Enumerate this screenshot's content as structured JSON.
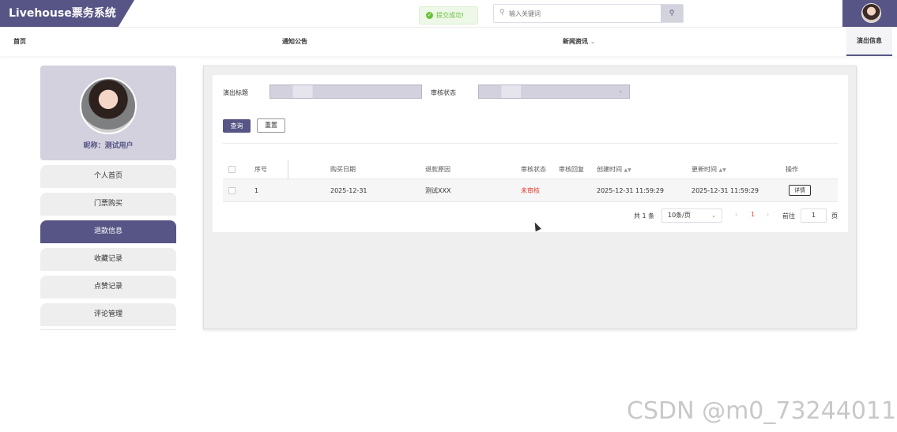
{
  "app": {
    "title": "Livehouse票务系统"
  },
  "toast": {
    "text": "提交成功!"
  },
  "search": {
    "placeholder": "输入关键词",
    "search_icon": "search-icon",
    "button_icon": "search-icon"
  },
  "nav": {
    "items": [
      {
        "label": "首页"
      },
      {
        "label": "通知公告"
      },
      {
        "label": "新闻资讯",
        "chevron": "chevron-down-icon"
      },
      {
        "label": "演出信息",
        "active": true
      }
    ]
  },
  "profile": {
    "nickname": "昵称：测试用户"
  },
  "sidebar": {
    "items": [
      {
        "label": "个人首页"
      },
      {
        "label": "门票购买"
      },
      {
        "label": "退款信息",
        "active": true
      },
      {
        "label": "收藏记录"
      },
      {
        "label": "点赞记录"
      },
      {
        "label": "评论管理"
      }
    ]
  },
  "filters": {
    "title_label": "演出标题",
    "status_label": "审核状态",
    "title_value": "",
    "status_value": ""
  },
  "buttons": {
    "query": "查询",
    "reset": "重置"
  },
  "table": {
    "headers": [
      "序号",
      "购买日期",
      "退款原因",
      "审核状态",
      "审核回复",
      "创建时间",
      "更新时间",
      "操作"
    ],
    "rows": [
      {
        "index": "1",
        "purchase_date": "2025-12-31",
        "reason": "测试XXX",
        "status": "未审核",
        "reply": "",
        "created": "2025-12-31 11:59:29",
        "updated": "2025-12-31 11:59:29",
        "action": "详情"
      }
    ]
  },
  "pagination": {
    "total": "共 1 条",
    "page_size": "10条/页",
    "current_page": "1",
    "goto_label": "前往",
    "goto_value": "1",
    "page_unit": "页"
  },
  "watermark": "CSDN @m0_73244011",
  "colors": {
    "accent": "#575585",
    "accent_light": "#d3d1de",
    "status_pending": "#e53e31",
    "toast_green": "#67c23a"
  }
}
